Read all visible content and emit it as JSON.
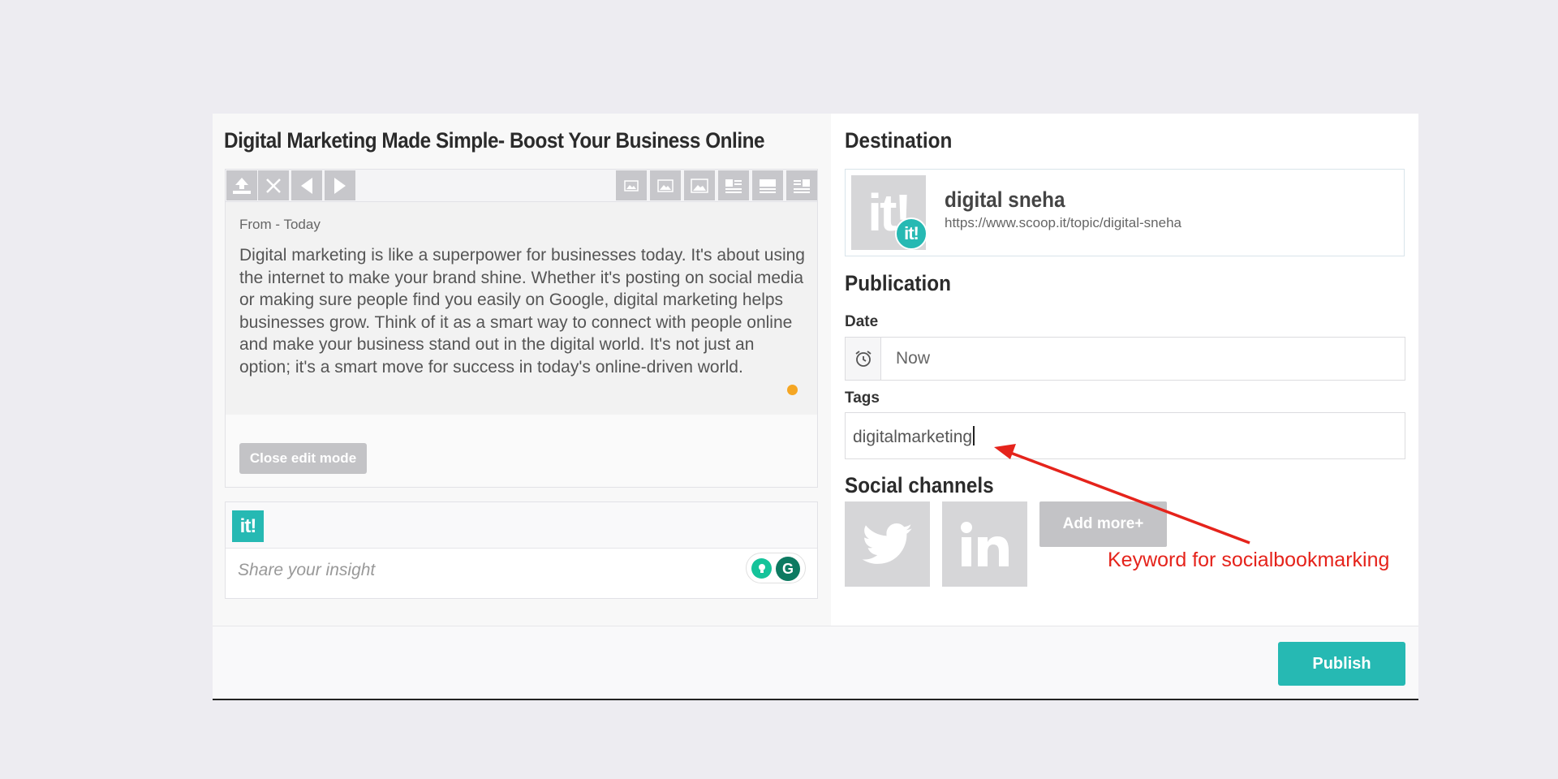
{
  "editor": {
    "title": "Digital Marketing Made Simple- Boost Your Business Online",
    "from": "From - Today",
    "body": "Digital marketing is like a superpower for businesses today. It's about using the internet to make your brand shine. Whether it's posting on social media or making sure people find you easily on Google, digital marketing helps businesses grow. Think of it as a smart way to connect with people online and make your business stand out in the digital world. It's not just an option; it's a smart move for success in today's online-driven world.",
    "close_label": "Close edit mode",
    "insight_logo": "it!",
    "insight_placeholder": "Share your insight"
  },
  "destination": {
    "heading": "Destination",
    "logo": "it!",
    "badge": "it!",
    "name": "digital sneha",
    "url": "https://www.scoop.it/topic/digital-sneha"
  },
  "publication": {
    "heading": "Publication",
    "date_label": "Date",
    "date_value": "Now",
    "tags_label": "Tags",
    "tags_value": "digitalmarketing"
  },
  "social": {
    "heading": "Social channels",
    "channels": [
      "twitter",
      "linkedin"
    ],
    "add_more": "Add more+"
  },
  "annotation": {
    "text": "Keyword for socialbookmarking",
    "color": "#e5231b"
  },
  "footer": {
    "publish_label": "Publish"
  },
  "colors": {
    "accent": "#26b9b3",
    "background": "#edecf1",
    "disabled": "#c3c3c6"
  }
}
